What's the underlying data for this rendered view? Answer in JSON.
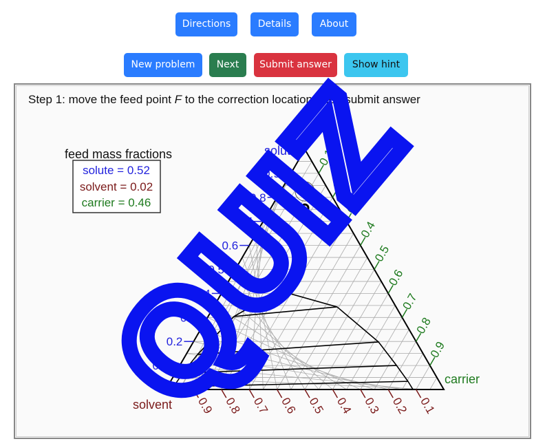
{
  "nav": {
    "directions": "Directions",
    "details": "Details",
    "about": "About"
  },
  "actions": {
    "new_problem": "New problem",
    "next": "Next",
    "submit": "Submit answer",
    "hint": "Show hint"
  },
  "colors": {
    "primary": "#2a7cff",
    "success": "#2a7d4f",
    "danger": "#d9333f",
    "info": "#3cc6ef",
    "solute": "#2222dd",
    "solvent": "#7a1a1a",
    "carrier": "#1e7a1e",
    "watermark": "#0a14f0"
  },
  "instruction": {
    "prefix": "Step 1: move the feed point ",
    "var": "F",
    "suffix": " to the correction location, then submit answer"
  },
  "legend": {
    "title": "feed mass fractions",
    "solute": "solute = 0.52",
    "solvent": "solvent = 0.02",
    "carrier": "carrier = 0.46"
  },
  "watermark": "QUIZ",
  "chart_data": {
    "type": "ternary",
    "vertices": {
      "top": "solute",
      "left": "solvent",
      "right": "carrier"
    },
    "grid_step": 0.05,
    "solute_ticks": [
      "0.1",
      "0.2",
      "0.3",
      "0.4",
      "0.5",
      "0.6",
      "0.7",
      "0.8",
      "0.9"
    ],
    "solvent_ticks": [
      "0.9",
      "0.8",
      "0.7",
      "0.6",
      "0.5",
      "0.4",
      "0.3",
      "0.2",
      "0.1"
    ],
    "carrier_ticks": [
      "0.1",
      "0.2",
      "0.3",
      "0.4",
      "0.5",
      "0.6",
      "0.7",
      "0.8",
      "0.9"
    ],
    "binodal": [
      [
        0,
        0.02
      ],
      [
        0.011,
        0.022
      ],
      [
        0.069,
        0.027
      ],
      [
        0.146,
        0.041
      ],
      [
        0.304,
        0.093
      ],
      [
        0.37,
        0.159
      ],
      [
        0.398,
        0.251
      ],
      [
        0.344,
        0.444
      ],
      [
        0.198,
        0.666
      ],
      [
        0.1,
        0.78
      ],
      [
        0.034,
        0.854
      ],
      [
        0,
        0.889
      ]
    ],
    "binodal_format": "[solute, carrier]",
    "tie_lines": [
      [
        [
          0.304,
          0.093
        ],
        [
          0.344,
          0.444
        ]
      ],
      [
        [
          0.146,
          0.041
        ],
        [
          0.198,
          0.666
        ]
      ],
      [
        [
          0.069,
          0.027
        ],
        [
          0.1,
          0.78
        ]
      ],
      [
        [
          0.011,
          0.022
        ],
        [
          0.034,
          0.854
        ]
      ]
    ],
    "feed_point": {
      "label": "F",
      "solute": 0.756,
      "carrier": 0.122
    }
  }
}
